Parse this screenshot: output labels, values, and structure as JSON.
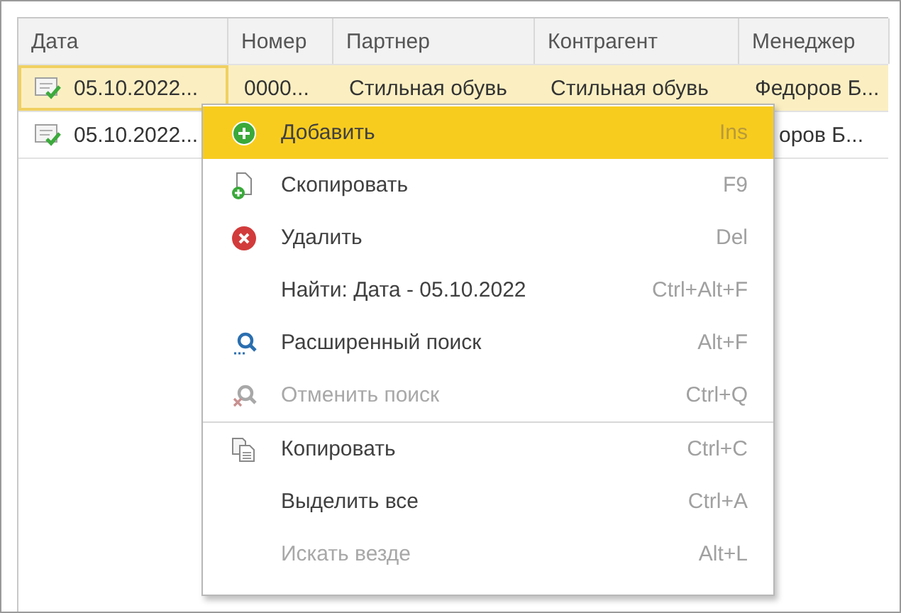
{
  "table": {
    "columns": [
      "Дата",
      "Номер",
      "Партнер",
      "Контрагент",
      "Менеджер"
    ],
    "rows": [
      {
        "selected": true,
        "cells": [
          "05.10.2022...",
          "0000...",
          "Стильная обувь",
          "Стильная обувь",
          "Федоров Б..."
        ]
      },
      {
        "selected": false,
        "cells": [
          "05.10.2022...",
          "",
          "",
          "",
          "оров Б..."
        ]
      }
    ]
  },
  "menu": {
    "items": [
      {
        "kind": "add",
        "label": "Добавить",
        "shortcut": "Ins",
        "selected": true,
        "disabled": false
      },
      {
        "kind": "copy-new",
        "label": "Скопировать",
        "shortcut": "F9",
        "selected": false,
        "disabled": false
      },
      {
        "kind": "delete",
        "label": "Удалить",
        "shortcut": "Del",
        "selected": false,
        "disabled": false
      },
      {
        "kind": "plain",
        "label": "Найти: Дата - 05.10.2022",
        "shortcut": "Ctrl+Alt+F",
        "selected": false,
        "disabled": false
      },
      {
        "kind": "search",
        "label": "Расширенный поиск",
        "shortcut": "Alt+F",
        "selected": false,
        "disabled": false
      },
      {
        "kind": "cancel-search",
        "label": "Отменить поиск",
        "shortcut": "Ctrl+Q",
        "selected": false,
        "disabled": true
      },
      {
        "kind": "separator"
      },
      {
        "kind": "clipboard",
        "label": "Копировать",
        "shortcut": "Ctrl+C",
        "selected": false,
        "disabled": false
      },
      {
        "kind": "plain",
        "label": "Выделить все",
        "shortcut": "Ctrl+A",
        "selected": false,
        "disabled": false
      },
      {
        "kind": "plain",
        "label": "Искать везде",
        "shortcut": "Alt+L",
        "selected": false,
        "disabled": true
      }
    ]
  }
}
